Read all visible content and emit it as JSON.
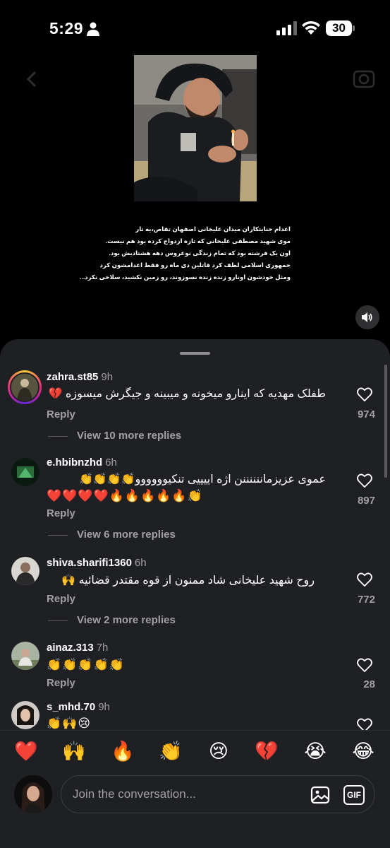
{
  "status_bar": {
    "time": "5:29",
    "battery": "30"
  },
  "post": {
    "caption_lines": [
      "اعدام جنایتکاران میدان علیخانی اصفهان تقاص،یه تار",
      "موی شهید مصطفی علیخانی که تازه ازدواج کرده بود هم نیست.",
      "اون یک فرشته بود که تمام زندگی نوعروس دهه هشتادیش بود.",
      "جمهوری اسلامی لطف کرد قاتلین دی ماه رو فقط اعدامشون کرد",
      "ومثل خودشون اونارو زنده زنده نسوزوند، رو زمین نکشید، سلاخی نکرد..."
    ]
  },
  "comments": [
    {
      "username": "zahra.st85",
      "time": "9h",
      "text": "طفلک مهدیه که اینارو میخونه و میبینه و جیگرش میسوزه 💔",
      "emoji": "",
      "reply_label": "Reply",
      "likes": "974",
      "view_replies": "View 10 more replies"
    },
    {
      "username": "e.hbibnzhd",
      "time": "6h",
      "text": "عموی عزیزماننننننن اژه اییییی تنکیوووووو👏👏👏👏",
      "emoji": "❤️❤️❤️❤️🔥🔥🔥🔥🔥👏",
      "reply_label": "Reply",
      "likes": "897",
      "view_replies": "View 6 more replies"
    },
    {
      "username": "shiva.sharifi1360",
      "time": "6h",
      "text": "روح شهید علیخانی شاد  ممنون از قوه مقتدر قضائیه 🙌",
      "emoji": "",
      "reply_label": "Reply",
      "likes": "772",
      "view_replies": "View 2 more replies"
    },
    {
      "username": "ainaz.313",
      "time": "7h",
      "text": "",
      "emoji": "👏👏👏👏👏",
      "reply_label": "Reply",
      "likes": "28",
      "view_replies": ""
    },
    {
      "username": "s_mhd.70",
      "time": "9h",
      "text": "",
      "emoji": "👏🙌😢",
      "reply_label": "",
      "likes": "",
      "view_replies": ""
    }
  ],
  "reactions": [
    "❤️",
    "🙌",
    "🔥",
    "👏",
    "😢",
    "💔",
    "😭",
    "😂"
  ],
  "composer": {
    "placeholder": "Join the conversation...",
    "gif_label": "GIF"
  }
}
